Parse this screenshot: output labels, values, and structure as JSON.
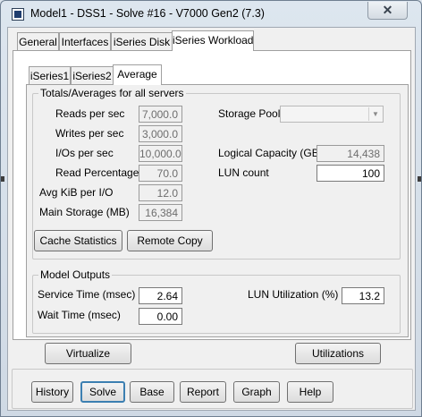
{
  "window": {
    "title": "Model1 - DSS1 - Solve #16 - V7000 Gen2 (7.3)",
    "close_glyph": "✕"
  },
  "main_tabs": [
    {
      "label": "General",
      "active": false
    },
    {
      "label": "Interfaces",
      "active": false
    },
    {
      "label": "iSeries Disk",
      "active": false
    },
    {
      "label": "iSeries Workload",
      "active": true
    }
  ],
  "sub_tabs": [
    {
      "label": "iSeries1",
      "active": false
    },
    {
      "label": "iSeries2",
      "active": false
    },
    {
      "label": "Average",
      "active": true
    }
  ],
  "totals": {
    "title": "Totals/Averages for all servers",
    "reads_label": "Reads per sec",
    "reads_value": "7,000.0",
    "writes_label": "Writes per sec",
    "writes_value": "3,000.0",
    "ios_label": "I/Os per sec",
    "ios_value": "10,000.0",
    "read_pct_label": "Read Percentage",
    "read_pct_value": "70.0",
    "avg_kib_label": "Avg KiB per I/O",
    "avg_kib_value": "12.0",
    "main_storage_label": "Main Storage (MB)",
    "main_storage_value": "16,384",
    "storage_pool_label": "Storage Pool",
    "storage_pool_value": "",
    "logical_capacity_label": "Logical Capacity (GB)",
    "logical_capacity_value": "14,438",
    "lun_count_label": "LUN count",
    "lun_count_value": "100",
    "cache_button": "Cache Statistics",
    "remote_button": "Remote Copy"
  },
  "outputs": {
    "title": "Model Outputs",
    "service_time_label": "Service Time (msec)",
    "service_time_value": "2.64",
    "wait_time_label": "Wait Time (msec)",
    "wait_time_value": "0.00",
    "lun_util_label": "LUN Utilization (%)",
    "lun_util_value": "13.2"
  },
  "actions": {
    "virtualize": "Virtualize",
    "utilizations": "Utilizations"
  },
  "footer_buttons": {
    "history": "History",
    "solve": "Solve",
    "base": "Base",
    "report": "Report",
    "graph": "Graph",
    "help": "Help"
  },
  "icons": {
    "app_icon": "app-icon",
    "dropdown_icon": "chevron-down-icon",
    "close_icon": "close-icon"
  }
}
